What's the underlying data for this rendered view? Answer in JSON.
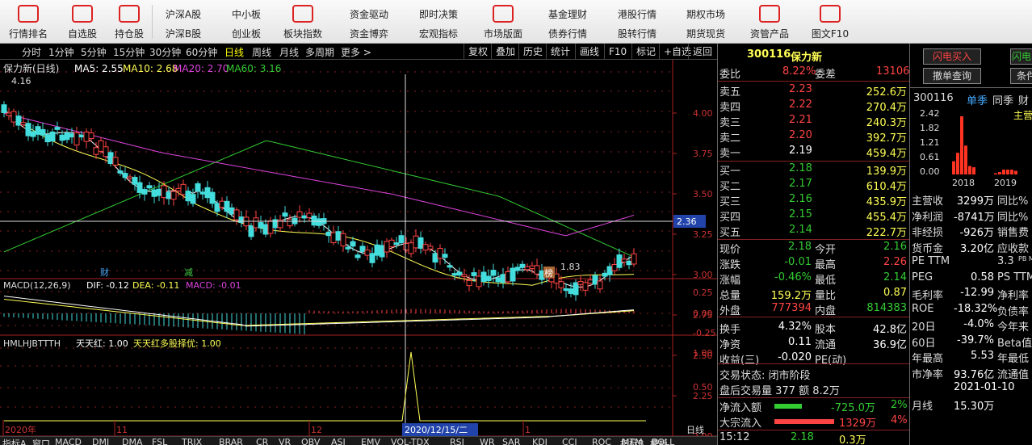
{
  "toolbar": {
    "singles": [
      "行情排名",
      "自选股",
      "持仓股"
    ],
    "pairs": [
      [
        "沪深A股",
        "沪深B股"
      ],
      [
        "中小板",
        "创业板"
      ],
      [
        "板块指数",
        ""
      ],
      [
        "资金驱动",
        "资金博弈"
      ],
      [
        "即时决策",
        "宏观指标"
      ],
      [
        "市场版面",
        ""
      ],
      [
        "基金理财",
        "债券行情"
      ],
      [
        "港股行情",
        "股转行情"
      ],
      [
        "期权市场",
        "期货现货"
      ],
      [
        "资管产品",
        ""
      ],
      [
        "图文F10",
        ""
      ]
    ]
  },
  "tabs": {
    "periods": [
      "分时",
      "1分钟",
      "5分钟",
      "15分钟",
      "30分钟",
      "60分钟",
      "日线",
      "周线",
      "月线",
      "多周期",
      "更多 >"
    ],
    "active": "日线",
    "tools": [
      "复权",
      "叠加",
      "历史",
      "统计",
      "画线",
      "F10",
      "标记",
      "+自选",
      "返回"
    ]
  },
  "chart": {
    "title": "保力新(日线)",
    "ma": {
      "ma5": "MA5: 2.55",
      "ma10": "MA10: 2.68",
      "ma20": "MA20: 2.70",
      "ma60": "MA60: 3.16"
    },
    "high_mark": "4.16",
    "low_mark": "1.83",
    "cursor_price": "2.36",
    "yticks": [
      "4.00",
      "3.75",
      "3.50",
      "3.25",
      "3.00",
      "2.75",
      "2.50",
      "2.25",
      "2.00"
    ],
    "markers": {
      "cai": "财",
      "jian": "减",
      "bang": "榜"
    },
    "macd": {
      "title": "MACD(12,26,9)",
      "dif": "DIF: -0.12",
      "dea": "DEA: -0.11",
      "macd": "MACD: -0.01",
      "ticks": [
        "0.25",
        "0.00",
        "-0.25"
      ]
    },
    "ind": {
      "title": "HMLHJBTTTH",
      "a": "天天红: 1.00",
      "b": "天天红多股择优: 1.00",
      "ticks": [
        "1.00",
        "0.50"
      ]
    },
    "xaxis": [
      "2020年",
      "11",
      "12",
      "1"
    ],
    "cursor_date": "2020/12/15/二",
    "period_label": "日线",
    "bottom_tabs": [
      "指标A",
      "窗口",
      "MACD",
      "DMI",
      "DMA",
      "FSL",
      "TRIX",
      "BRAR",
      "CR",
      "VR",
      "OBV",
      "ASI",
      "EMV",
      "VOL-TDX",
      "RSI",
      "WR",
      "SAR",
      "KDJ",
      "CCI",
      "ROC",
      "MTM",
      "BOLL",
      "指标B",
      "模板"
    ]
  },
  "quote": {
    "code": "300116",
    "name": "保力新",
    "weibi": {
      "l": "委比",
      "v": "8.22%",
      "l2": "委差",
      "v2": "13106"
    },
    "asks": [
      [
        "卖五",
        "2.23",
        "252.6万"
      ],
      [
        "卖四",
        "2.22",
        "270.4万"
      ],
      [
        "卖三",
        "2.21",
        "240.3万"
      ],
      [
        "卖二",
        "2.20",
        "392.7万"
      ],
      [
        "卖一",
        "2.19",
        "459.4万"
      ]
    ],
    "bids": [
      [
        "买一",
        "2.18",
        "139.9万"
      ],
      [
        "买二",
        "2.17",
        "610.4万"
      ],
      [
        "买三",
        "2.16",
        "435.9万"
      ],
      [
        "买四",
        "2.15",
        "455.4万"
      ],
      [
        "买五",
        "2.14",
        "222.7万"
      ]
    ],
    "stats": [
      [
        "现价",
        "2.18",
        "今开",
        "2.16"
      ],
      [
        "涨跌",
        "-0.01",
        "最高",
        "2.26"
      ],
      [
        "涨幅",
        "-0.46%",
        "最低",
        "2.14"
      ],
      [
        "总量",
        "159.2万",
        "量比",
        "0.87"
      ],
      [
        "外盘",
        "777394",
        "内盘",
        "814383"
      ],
      [
        "换手",
        "4.32%",
        "股本",
        "42.8亿"
      ],
      [
        "净资",
        "0.11",
        "流通",
        "36.9亿"
      ],
      [
        "收益(三)",
        "-0.020",
        "PE(动)",
        ""
      ]
    ],
    "trade_status": "交易状态: 闭市阶段",
    "after": "盘后交易量 377 额 8.2万",
    "netin": {
      "l": "净流入额",
      "v": "-725.0万",
      "p": "2%"
    },
    "block": {
      "l": "大宗流入",
      "v": "1329万",
      "p": "4%"
    },
    "last": {
      "t": "15:12",
      "p": "2.18",
      "v": "0.3万"
    }
  },
  "far": {
    "btn1": "闪电买入",
    "btn2": "闪电卖",
    "btn3": "撤单查询",
    "btn4": "条件",
    "code": "300116",
    "seasons": [
      "单季",
      "同季",
      "财"
    ],
    "main": "主营",
    "chart_data": {
      "type": "bar",
      "yticks": [
        "2.42",
        "1.82",
        "1.21",
        "0.61",
        "0.00"
      ],
      "categories": [
        "2018",
        "2019"
      ],
      "values": [
        0.55,
        0.9,
        2.42,
        1.2,
        0.35,
        0.3,
        0.05,
        0.1,
        0.2,
        0.2,
        0.2,
        0.15
      ]
    },
    "rows": [
      [
        "主营收",
        "3299万",
        "同比%",
        ""
      ],
      [
        "净利润",
        "-8741万",
        "同比%",
        ""
      ],
      [
        "非经损",
        "-926万",
        "销售费",
        ""
      ],
      [
        "货币金",
        "3.20亿",
        "应收款",
        ""
      ],
      [
        "PE TTM",
        "",
        "3.3",
        "PB MRQ"
      ],
      [
        "PEG",
        "0.58",
        "PS TTM",
        ""
      ],
      [
        "毛利率",
        "-12.99",
        "净利率",
        ""
      ],
      [
        "ROE",
        "-18.32%",
        "负债率",
        ""
      ],
      [
        "20日",
        "-4.0%",
        "今年来",
        ""
      ],
      [
        "60日",
        "-39.7%",
        "Beta值",
        ""
      ],
      [
        "年最高",
        "5.53",
        "年最低",
        ""
      ],
      [
        "市净率",
        "93.76亿",
        "流通值",
        ""
      ],
      [
        "",
        "2021-01-10",
        ""
      ],
      [
        "月线",
        "15.30万",
        ""
      ]
    ]
  }
}
